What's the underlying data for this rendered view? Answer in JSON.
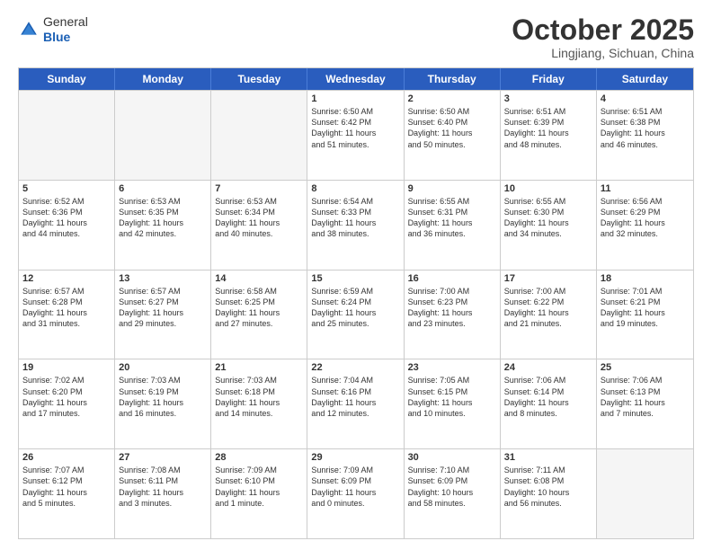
{
  "header": {
    "logo_general": "General",
    "logo_blue": "Blue",
    "title": "October 2025",
    "location": "Lingjiang, Sichuan, China"
  },
  "days_of_week": [
    "Sunday",
    "Monday",
    "Tuesday",
    "Wednesday",
    "Thursday",
    "Friday",
    "Saturday"
  ],
  "rows": [
    [
      {
        "day": "",
        "info": ""
      },
      {
        "day": "",
        "info": ""
      },
      {
        "day": "",
        "info": ""
      },
      {
        "day": "1",
        "info": "Sunrise: 6:50 AM\nSunset: 6:42 PM\nDaylight: 11 hours\nand 51 minutes."
      },
      {
        "day": "2",
        "info": "Sunrise: 6:50 AM\nSunset: 6:40 PM\nDaylight: 11 hours\nand 50 minutes."
      },
      {
        "day": "3",
        "info": "Sunrise: 6:51 AM\nSunset: 6:39 PM\nDaylight: 11 hours\nand 48 minutes."
      },
      {
        "day": "4",
        "info": "Sunrise: 6:51 AM\nSunset: 6:38 PM\nDaylight: 11 hours\nand 46 minutes."
      }
    ],
    [
      {
        "day": "5",
        "info": "Sunrise: 6:52 AM\nSunset: 6:36 PM\nDaylight: 11 hours\nand 44 minutes."
      },
      {
        "day": "6",
        "info": "Sunrise: 6:53 AM\nSunset: 6:35 PM\nDaylight: 11 hours\nand 42 minutes."
      },
      {
        "day": "7",
        "info": "Sunrise: 6:53 AM\nSunset: 6:34 PM\nDaylight: 11 hours\nand 40 minutes."
      },
      {
        "day": "8",
        "info": "Sunrise: 6:54 AM\nSunset: 6:33 PM\nDaylight: 11 hours\nand 38 minutes."
      },
      {
        "day": "9",
        "info": "Sunrise: 6:55 AM\nSunset: 6:31 PM\nDaylight: 11 hours\nand 36 minutes."
      },
      {
        "day": "10",
        "info": "Sunrise: 6:55 AM\nSunset: 6:30 PM\nDaylight: 11 hours\nand 34 minutes."
      },
      {
        "day": "11",
        "info": "Sunrise: 6:56 AM\nSunset: 6:29 PM\nDaylight: 11 hours\nand 32 minutes."
      }
    ],
    [
      {
        "day": "12",
        "info": "Sunrise: 6:57 AM\nSunset: 6:28 PM\nDaylight: 11 hours\nand 31 minutes."
      },
      {
        "day": "13",
        "info": "Sunrise: 6:57 AM\nSunset: 6:27 PM\nDaylight: 11 hours\nand 29 minutes."
      },
      {
        "day": "14",
        "info": "Sunrise: 6:58 AM\nSunset: 6:25 PM\nDaylight: 11 hours\nand 27 minutes."
      },
      {
        "day": "15",
        "info": "Sunrise: 6:59 AM\nSunset: 6:24 PM\nDaylight: 11 hours\nand 25 minutes."
      },
      {
        "day": "16",
        "info": "Sunrise: 7:00 AM\nSunset: 6:23 PM\nDaylight: 11 hours\nand 23 minutes."
      },
      {
        "day": "17",
        "info": "Sunrise: 7:00 AM\nSunset: 6:22 PM\nDaylight: 11 hours\nand 21 minutes."
      },
      {
        "day": "18",
        "info": "Sunrise: 7:01 AM\nSunset: 6:21 PM\nDaylight: 11 hours\nand 19 minutes."
      }
    ],
    [
      {
        "day": "19",
        "info": "Sunrise: 7:02 AM\nSunset: 6:20 PM\nDaylight: 11 hours\nand 17 minutes."
      },
      {
        "day": "20",
        "info": "Sunrise: 7:03 AM\nSunset: 6:19 PM\nDaylight: 11 hours\nand 16 minutes."
      },
      {
        "day": "21",
        "info": "Sunrise: 7:03 AM\nSunset: 6:18 PM\nDaylight: 11 hours\nand 14 minutes."
      },
      {
        "day": "22",
        "info": "Sunrise: 7:04 AM\nSunset: 6:16 PM\nDaylight: 11 hours\nand 12 minutes."
      },
      {
        "day": "23",
        "info": "Sunrise: 7:05 AM\nSunset: 6:15 PM\nDaylight: 11 hours\nand 10 minutes."
      },
      {
        "day": "24",
        "info": "Sunrise: 7:06 AM\nSunset: 6:14 PM\nDaylight: 11 hours\nand 8 minutes."
      },
      {
        "day": "25",
        "info": "Sunrise: 7:06 AM\nSunset: 6:13 PM\nDaylight: 11 hours\nand 7 minutes."
      }
    ],
    [
      {
        "day": "26",
        "info": "Sunrise: 7:07 AM\nSunset: 6:12 PM\nDaylight: 11 hours\nand 5 minutes."
      },
      {
        "day": "27",
        "info": "Sunrise: 7:08 AM\nSunset: 6:11 PM\nDaylight: 11 hours\nand 3 minutes."
      },
      {
        "day": "28",
        "info": "Sunrise: 7:09 AM\nSunset: 6:10 PM\nDaylight: 11 hours\nand 1 minute."
      },
      {
        "day": "29",
        "info": "Sunrise: 7:09 AM\nSunset: 6:09 PM\nDaylight: 11 hours\nand 0 minutes."
      },
      {
        "day": "30",
        "info": "Sunrise: 7:10 AM\nSunset: 6:09 PM\nDaylight: 10 hours\nand 58 minutes."
      },
      {
        "day": "31",
        "info": "Sunrise: 7:11 AM\nSunset: 6:08 PM\nDaylight: 10 hours\nand 56 minutes."
      },
      {
        "day": "",
        "info": ""
      }
    ]
  ]
}
